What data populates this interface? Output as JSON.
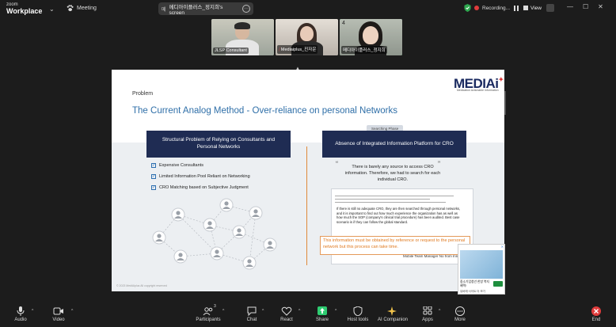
{
  "topbar": {
    "brand_small": "zoom",
    "brand_main": "Workplace",
    "meeting_label": "Meeting",
    "share_lang": "메",
    "share_label": "메디아이플러스_정지희's screen",
    "recording_label": "Recording...",
    "view_label": "View"
  },
  "tiles": [
    {
      "name": "JLSP Consultant",
      "muted": false
    },
    {
      "name": "Mediaiplus_진자운",
      "muted": true
    },
    {
      "name": "메디아이플러스_정지희",
      "muted": false,
      "number": "4",
      "active": true
    }
  ],
  "slide": {
    "logo": "MEDIAi",
    "logo_sub": "Medication Actionable Information",
    "section": "Problem",
    "title": "The Current Analog Method -  Over-reliance on personal Networks",
    "left_header": "Structural Problem of Relying on Consultants and Personal Networks",
    "right_header": "Absence of Integrated Information Platform for CRO",
    "tab_label": "Searching Phase",
    "checklist": [
      "Expensive Consultants",
      "Limited Information Pool Reliant on Networking",
      "CRO Matching based on Subjective Judgment"
    ],
    "quote": "There is barely any source to access CRO information. Therefore, we had to search for each individual CRO.",
    "doc_text": "If there is still no adequate CRO, they are then searched through personal networks, and it is important to find out how much experience the organization has as well as how much the SOP (company's clinical trial procedure) has been audited. Best case scenario is if they can follow the global standard.",
    "doc_signature": "Mobile Team Manager No from Inn",
    "callout": "This information must be obtained by reference or request to the personal network but this process can take time.",
    "copyright": "© 2023 MediAiplus All copyright reserved"
  },
  "ad": {
    "header": "Ad",
    "text": "중소기업청년 한방 복지혜택!",
    "footer": "유비에 사이트 더 보기"
  },
  "toolbar": {
    "audio": "Audio",
    "video": "Video",
    "participants": "Participants",
    "participants_count": "3",
    "chat": "Chat",
    "react": "React",
    "share": "Share",
    "host_tools": "Host tools",
    "ai_companion": "AI Companion",
    "apps": "Apps",
    "more": "More",
    "end": "End"
  },
  "colors": {
    "accent_green": "#4fd07d",
    "slide_navy": "#1f2c53",
    "slide_title_blue": "#2f6fa8",
    "callout_orange": "#e07a20",
    "end_red": "#e03c3c"
  }
}
